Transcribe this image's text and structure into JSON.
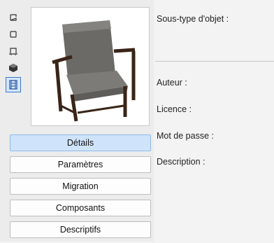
{
  "view_icons": [
    {
      "name": "plan-symbol-icon"
    },
    {
      "name": "section-symbol-icon"
    },
    {
      "name": "elevation-symbol-icon"
    },
    {
      "name": "3d-view-icon"
    },
    {
      "name": "preview-picture-icon",
      "active": true
    }
  ],
  "tabs": [
    {
      "label": "Détails",
      "active": true
    },
    {
      "label": "Paramètres"
    },
    {
      "label": "Migration"
    },
    {
      "label": "Composants"
    },
    {
      "label": "Descriptifs"
    }
  ],
  "fields": {
    "subtype_label": "Sous-type d'objet :",
    "author_label": "Auteur :",
    "license_label": "Licence :",
    "password_label": "Mot de passe :",
    "description_label": "Description :"
  },
  "colors": {
    "active_tab": "#cfe4fb",
    "accent": "#3a78c8"
  }
}
